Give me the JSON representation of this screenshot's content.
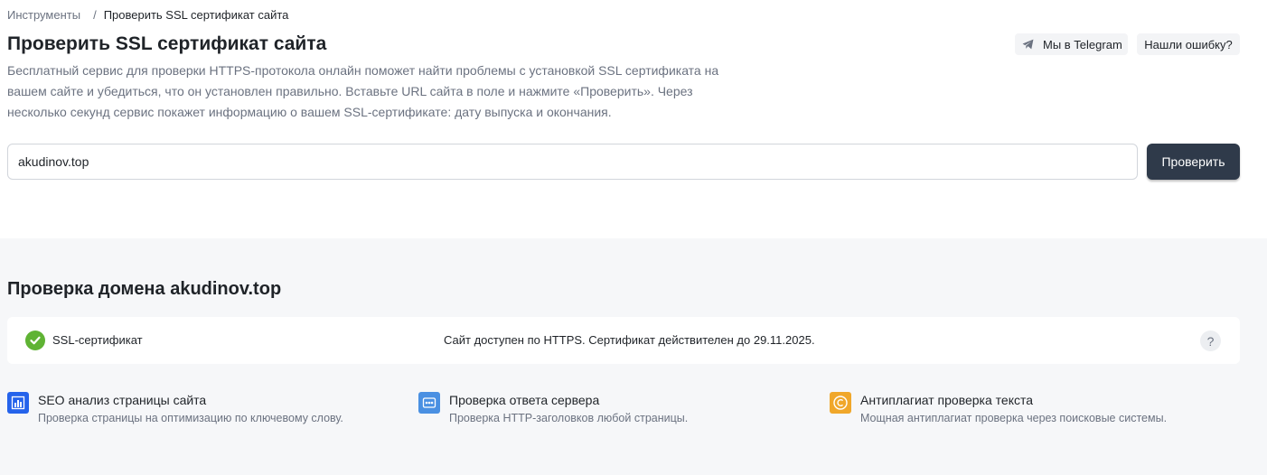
{
  "breadcrumb": {
    "parent": "Инструменты",
    "separator": "/",
    "current": "Проверить SSL сертификат сайта"
  },
  "page": {
    "title": "Проверить SSL сертификат сайта",
    "description": "Бесплатный сервис для проверки HTTPS-протокола онлайн поможет найти проблемы с установкой SSL сертификата на вашем сайте и убедиться, что он установлен правильно. Вставьте URL сайта в поле и нажмите «Проверить». Через несколько секунд сервис покажет информацию о вашем SSL-сертификате: дату выпуска и окончания."
  },
  "header_buttons": {
    "telegram": "Мы в Telegram",
    "telegram_icon": "send-icon",
    "report_error": "Нашли ошибку?"
  },
  "form": {
    "url_value": "akudinov.top",
    "submit_label": "Проверить"
  },
  "results": {
    "title": "Проверка домена akudinov.top",
    "checks": [
      {
        "label": "SSL-сертификат",
        "status_icon": "check-circle-icon",
        "status_color": "#5fb334",
        "message": "Сайт доступен по HTTPS. Сертификат действителен до 29.11.2025.",
        "help": "?"
      }
    ]
  },
  "related_tools": [
    {
      "title": "SEO анализ страницы сайта",
      "subtitle": "Проверка страницы на оптимизацию по ключевому слову.",
      "icon": "bar-chart-icon",
      "color": "#2563eb"
    },
    {
      "title": "Проверка ответа сервера",
      "subtitle": "Проверка HTTP-заголовков любой страницы.",
      "icon": "server-response-icon",
      "color": "#4a90e2"
    },
    {
      "title": "Антиплагиат проверка текста",
      "subtitle": "Мощная антиплагиат проверка через поисковые системы.",
      "icon": "copyright-icon",
      "color": "#f0a72a"
    }
  ],
  "colors": {
    "primary_button": "#2f3a4a",
    "success": "#5fb334",
    "section_background": "#f6f7f9"
  }
}
